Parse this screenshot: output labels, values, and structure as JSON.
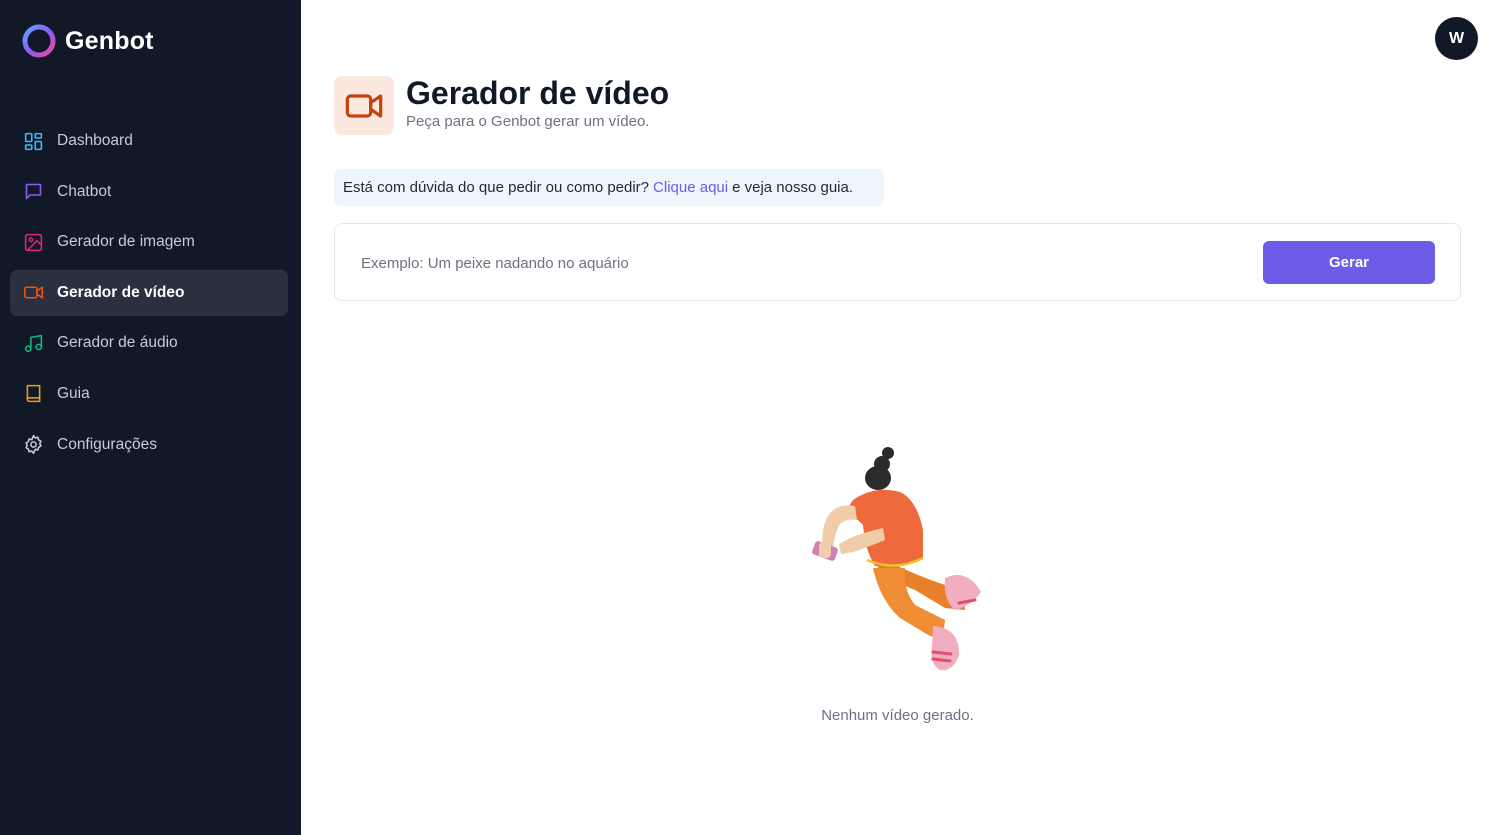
{
  "app": {
    "name": "Genbot"
  },
  "sidebar": {
    "items": [
      {
        "label": "Dashboard",
        "icon": "dashboard-icon",
        "color": "#38bdf8",
        "active": false
      },
      {
        "label": "Chatbot",
        "icon": "chat-icon",
        "color": "#8b5cf6",
        "active": false
      },
      {
        "label": "Gerador de imagem",
        "icon": "image-icon",
        "color": "#db2777",
        "active": false
      },
      {
        "label": "Gerador de vídeo",
        "icon": "video-icon",
        "color": "#ea580c",
        "active": true
      },
      {
        "label": "Gerador de áudio",
        "icon": "music-icon",
        "color": "#10b981",
        "active": false
      },
      {
        "label": "Guia",
        "icon": "book-icon",
        "color": "#f59e0b",
        "active": false
      },
      {
        "label": "Configurações",
        "icon": "gear-icon",
        "color": "#c7cbd3",
        "active": false
      }
    ]
  },
  "user": {
    "avatar_initial": "W"
  },
  "header": {
    "title": "Gerador de vídeo",
    "subtitle": "Peça para o Genbot gerar um vídeo.",
    "icon": "video-icon",
    "accent": "#c2410c"
  },
  "hint": {
    "before": "Está com dúvida do que pedir ou como pedir?",
    "link": "Clique aqui",
    "after": "e veja nosso guia."
  },
  "form": {
    "placeholder": "Exemplo: Um peixe nadando no aquário",
    "value": "",
    "button_label": "Gerar"
  },
  "empty_state": {
    "message": "Nenhum vídeo gerado."
  },
  "colors": {
    "sidebar_bg": "#111827",
    "primary": "#6d5ce7"
  }
}
